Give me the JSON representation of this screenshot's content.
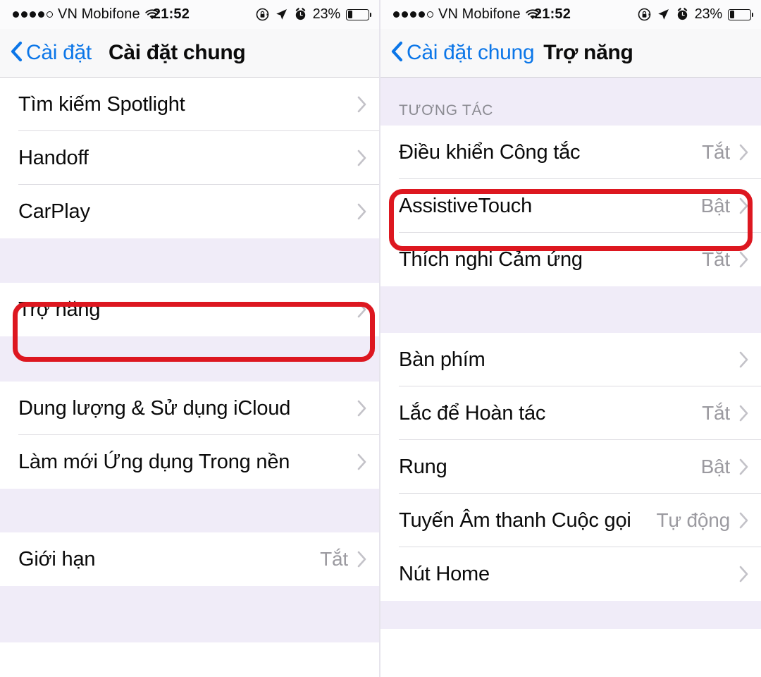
{
  "meta": {
    "accent_blue": "#0b76e8",
    "highlight_red": "#dd1720",
    "group_bg": "#ffffff",
    "page_bg": "#f0ecf8",
    "value_gray": "#9b9aa0",
    "chevron_gray": "#c3c2c8"
  },
  "status_bar": {
    "signal_dots_filled": 4,
    "signal_dots_total": 5,
    "carrier": "VN Mobifone",
    "wifi_icon": "wifi-icon",
    "time": "21:52",
    "rotation_lock_icon": "rotation-lock-icon",
    "location_icon": "location-arrow-icon",
    "alarm_icon": "alarm-clock-icon",
    "battery_percent": "23%",
    "battery_level": 23,
    "battery_icon": "battery-icon"
  },
  "left_screen": {
    "nav": {
      "back_label": "Cài đặt",
      "back_icon": "chevron-left-icon",
      "title": "Cài đặt chung"
    },
    "sections": [
      {
        "rows": [
          {
            "label": "Tìm kiếm Spotlight",
            "value": "",
            "chevron": "chevron-right-icon"
          },
          {
            "label": "Handoff",
            "value": "",
            "chevron": "chevron-right-icon"
          },
          {
            "label": "CarPlay",
            "value": "",
            "chevron": "chevron-right-icon"
          }
        ]
      },
      {
        "rows": [
          {
            "label": "Trợ năng",
            "value": "",
            "chevron": "chevron-right-icon",
            "highlighted": true
          }
        ]
      },
      {
        "rows": [
          {
            "label": "Dung lượng & Sử dụng iCloud",
            "value": "",
            "chevron": "chevron-right-icon"
          },
          {
            "label": "Làm mới Ứng dụng Trong nền",
            "value": "",
            "chevron": "chevron-right-icon"
          }
        ]
      },
      {
        "rows": [
          {
            "label": "Giới hạn",
            "value": "Tắt",
            "chevron": "chevron-right-icon"
          }
        ]
      }
    ]
  },
  "right_screen": {
    "nav": {
      "back_label": "Cài đặt chung",
      "back_icon": "chevron-left-icon",
      "title": "Trợ năng"
    },
    "sections": [
      {
        "header": "TƯƠNG TÁC",
        "rows": [
          {
            "label": "Điều khiển Công tắc",
            "value": "Tắt",
            "chevron": "chevron-right-icon"
          },
          {
            "label": "AssistiveTouch",
            "value": "Bật",
            "chevron": "chevron-right-icon",
            "highlighted": true
          },
          {
            "label": "Thích nghi Cảm ứng",
            "value": "Tắt",
            "chevron": "chevron-right-icon"
          }
        ]
      },
      {
        "header": "",
        "rows": [
          {
            "label": "Bàn phím",
            "value": "",
            "chevron": "chevron-right-icon"
          },
          {
            "label": "Lắc để Hoàn tác",
            "value": "Tắt",
            "chevron": "chevron-right-icon"
          },
          {
            "label": "Rung",
            "value": "Bật",
            "chevron": "chevron-right-icon"
          },
          {
            "label": "Tuyến Âm thanh Cuộc gọi",
            "value": "Tự động",
            "chevron": "chevron-right-icon"
          },
          {
            "label": "Nút Home",
            "value": "",
            "chevron": "chevron-right-icon"
          }
        ]
      }
    ]
  }
}
